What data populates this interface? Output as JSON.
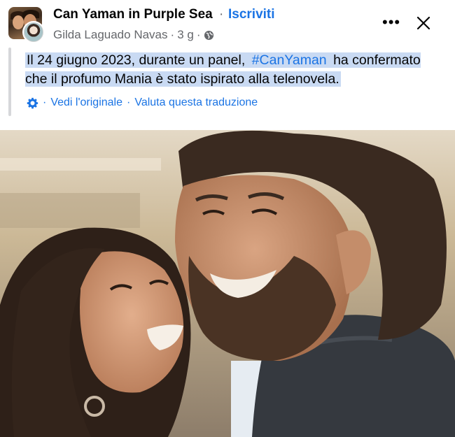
{
  "header": {
    "group_name": "Can Yaman in Purple Sea",
    "separator": "·",
    "join_label": "Iscriviti",
    "author": "Gilda Laguado Navas",
    "time": "3 g",
    "meta_separator": "·",
    "privacy_icon": "globe-icon",
    "more_icon": "more-options-icon",
    "close_icon": "close-icon"
  },
  "post": {
    "text_part1": "Il 24 giugno 2023, durante un panel, ",
    "hashtag": "#CanYaman",
    "text_part2": " ha confermato che il profumo Mania è stato ispirato alla telenovela.",
    "highlight_color": "#c9daf3"
  },
  "translation": {
    "settings_icon": "gear-icon",
    "separator": "·",
    "see_original": "Vedi l'originale",
    "rate_translation": "Valuta questa traduzione"
  },
  "colors": {
    "link": "#1b74e4",
    "secondary_text": "#65676b",
    "primary_text": "#050505"
  }
}
